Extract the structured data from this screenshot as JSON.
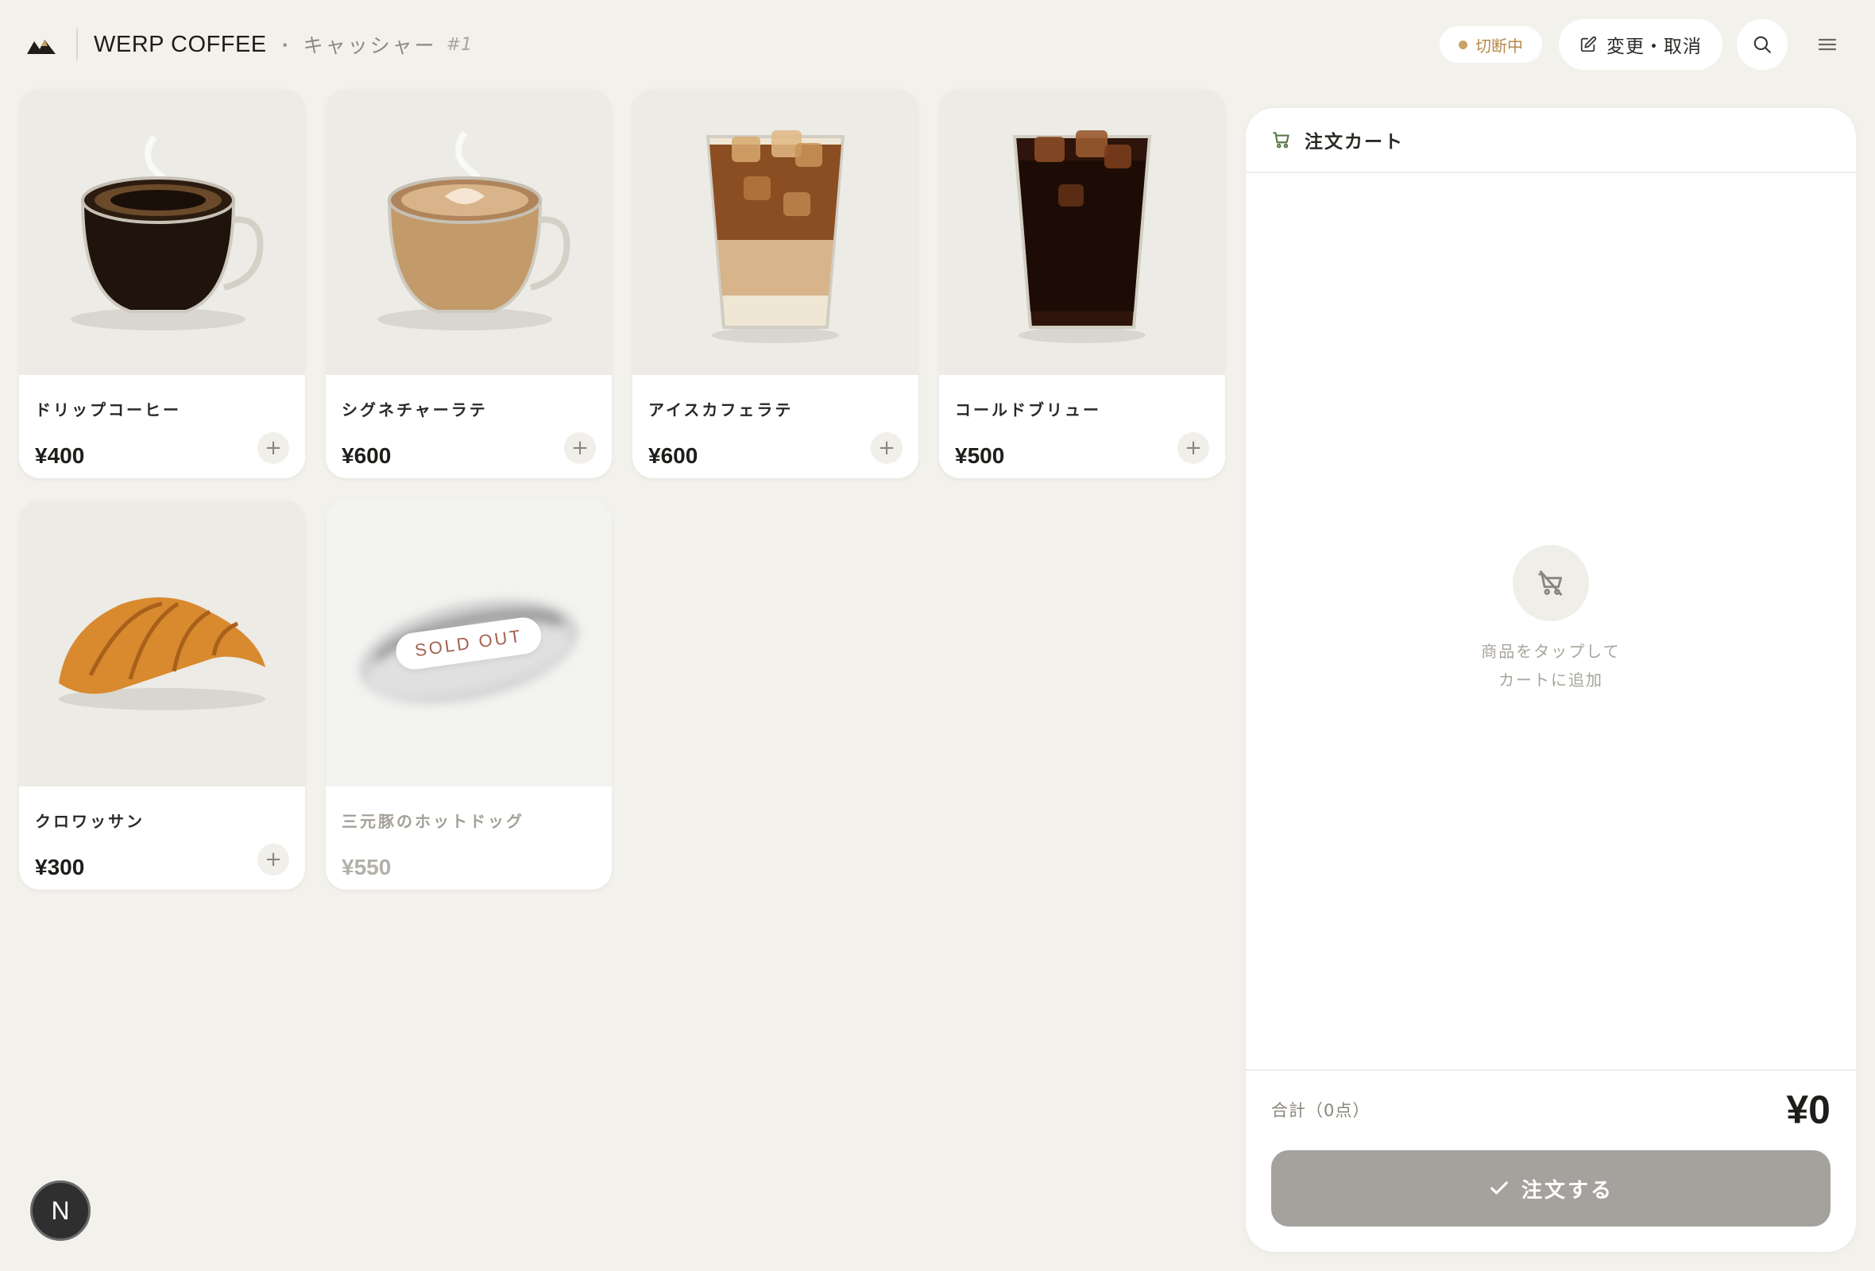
{
  "header": {
    "brand": "WERP COFFEE",
    "separator": "・",
    "role": "キャッシャー",
    "register": "#1",
    "status_text": "切断中",
    "edit_label": "変更・取消",
    "search_icon": "search-icon",
    "menu_icon": "hamburger-menu-icon"
  },
  "products": [
    {
      "name": "ドリップコーヒー",
      "price": "¥400",
      "add": "+"
    },
    {
      "name": "シグネチャーラテ",
      "price": "¥600",
      "add": "+"
    },
    {
      "name": "アイスカフェラテ",
      "price": "¥600",
      "add": "+"
    },
    {
      "name": "コールドブリュー",
      "price": "¥500",
      "add": "+"
    },
    {
      "name": "クロワッサン",
      "price": "¥300",
      "add": "+"
    },
    {
      "name": "三元豚のホットドッグ",
      "price": "¥550",
      "sold_out_label": "SOLD OUT"
    }
  ],
  "cart": {
    "title": "注文カート",
    "empty_line1": "商品をタップして",
    "empty_line2": "カートに追加",
    "total_label": "合計（0点）",
    "total_value": "¥0",
    "order_label": "注文する"
  },
  "badge": "N",
  "colors": {
    "background": "#f3f1ec",
    "accent_green": "#5d7a4a",
    "status_gold": "#c9a264",
    "disabled_button": "#a5a29e",
    "soldout_text": "#a2614f"
  }
}
